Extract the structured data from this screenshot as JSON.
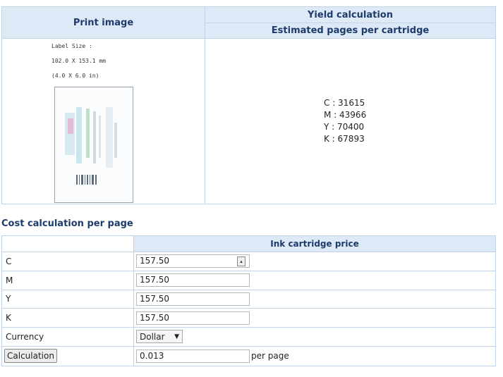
{
  "print_image": {
    "header": "Print image",
    "label_lines": [
      "Label Size :",
      "102.0 X 153.1 mm",
      "(4.0 X 6.0 in)"
    ]
  },
  "yield": {
    "header": "Yield calculation",
    "subheader": "Estimated pages per cartridge",
    "items": [
      "C : 31615",
      "M : 43966",
      "Y : 70400",
      "K : 67893"
    ]
  },
  "cost": {
    "title": "Cost calculation per page",
    "price_header": "Ink cartridge price",
    "rows": [
      {
        "label": "C",
        "value": "157.50"
      },
      {
        "label": "M",
        "value": "157.50"
      },
      {
        "label": "Y",
        "value": "157.50"
      },
      {
        "label": "K",
        "value": "157.50"
      }
    ],
    "currency_label": "Currency",
    "currency_value": "Dollar",
    "calc_button": "Calculation",
    "result_value": "0.013",
    "result_unit": "per page"
  }
}
